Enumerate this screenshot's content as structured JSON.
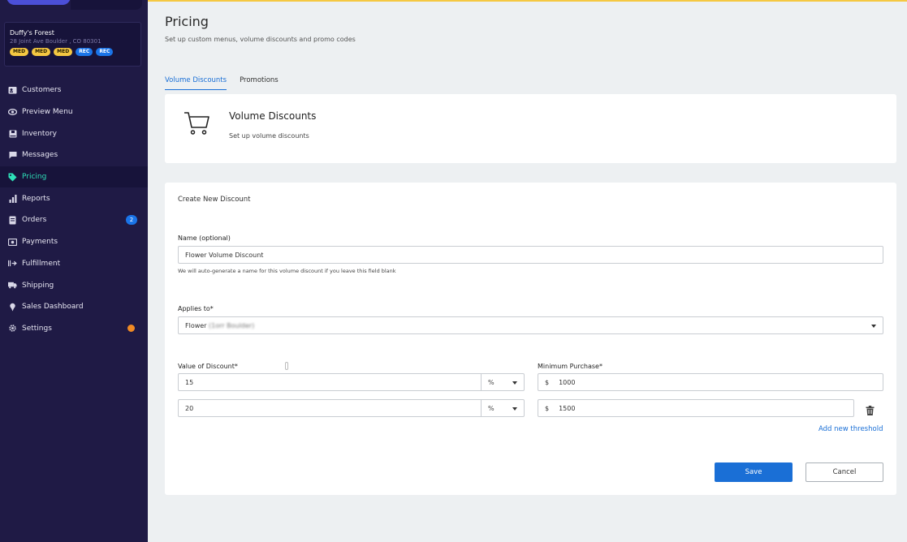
{
  "store": {
    "name": "Duffy's Forest",
    "address": "28 Joint Ave Boulder , CO 80301",
    "badges": [
      "MED",
      "MED",
      "MED",
      "REC",
      "REC"
    ]
  },
  "nav": {
    "items": [
      {
        "label": "Customers",
        "icon": "customers-icon"
      },
      {
        "label": "Preview Menu",
        "icon": "eye-icon"
      },
      {
        "label": "Inventory",
        "icon": "inventory-icon"
      },
      {
        "label": "Messages",
        "icon": "message-icon"
      },
      {
        "label": "Pricing",
        "icon": "tag-icon",
        "active": true
      },
      {
        "label": "Reports",
        "icon": "bar-chart-icon"
      },
      {
        "label": "Orders",
        "icon": "orders-icon",
        "badge": "2"
      },
      {
        "label": "Payments",
        "icon": "payments-icon"
      },
      {
        "label": "Fulfillment",
        "icon": "fulfillment-icon"
      },
      {
        "label": "Shipping",
        "icon": "truck-icon"
      },
      {
        "label": "Sales Dashboard",
        "icon": "pin-icon"
      },
      {
        "label": "Settings",
        "icon": "gear-icon",
        "alert": true
      }
    ]
  },
  "header": {
    "title": "Pricing",
    "subtitle": "Set up custom menus, volume discounts and promo codes"
  },
  "tabs": [
    {
      "label": "Volume Discounts",
      "active": true
    },
    {
      "label": "Promotions",
      "active": false
    }
  ],
  "volume_card": {
    "title": "Volume Discounts",
    "subtitle": "Set up volume discounts"
  },
  "form": {
    "title": "Create New Discount",
    "name_label": "Name (optional)",
    "name_value": "Flower Volume Discount",
    "name_hint": "We will auto-generate a name for this volume discount if you leave this field blank",
    "applies_label": "Applies to*",
    "applies_value": "Flower",
    "applies_blurred": "(1orr Boulder)",
    "value_label": "Value of Discount*",
    "min_label": "Minimum Purchase*",
    "thresholds": [
      {
        "value": "15",
        "unit": "%",
        "currency": "$",
        "min": "1000"
      },
      {
        "value": "20",
        "unit": "%",
        "currency": "$",
        "min": "1500"
      }
    ],
    "add_threshold": "Add new threshold",
    "save": "Save",
    "cancel": "Cancel"
  },
  "colors": {
    "sidebar_bg": "#1f1a45",
    "accent_active": "#2ee0b8",
    "primary": "#1a6fd6",
    "med_badge": "#f5c842",
    "rec_badge": "#1a74e8"
  }
}
